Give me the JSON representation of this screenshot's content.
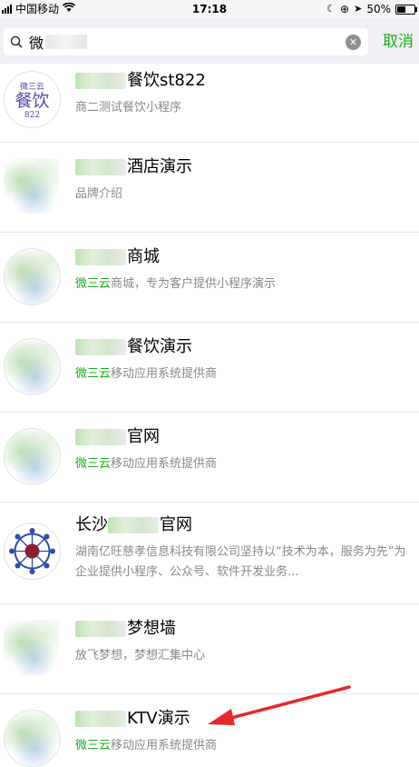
{
  "status": {
    "carrier": "中国移动",
    "time": "17:18",
    "battery_level": "50%",
    "battery_fraction": 0.5
  },
  "search": {
    "query": "微",
    "cancel_label": "取消",
    "clear_icon": "clear-icon",
    "search_icon": "search-icon"
  },
  "results": [
    {
      "title": "餐饮st822",
      "subtitle_highlight": "",
      "subtitle": "商二测试餐饮小程序",
      "logo_top": "微三云",
      "logo_mid": "餐饮",
      "logo_bot": "822"
    },
    {
      "title": "酒店演示",
      "subtitle_highlight": "",
      "subtitle": "品牌介绍"
    },
    {
      "title": "商城",
      "subtitle_highlight": "微三云",
      "subtitle": "商城，专为客户提供小程序演示"
    },
    {
      "title": "餐饮演示",
      "subtitle_highlight": "微三云",
      "subtitle": "移动应用系统提供商"
    },
    {
      "title": "官网",
      "subtitle_highlight": "微三云",
      "subtitle": "移动应用系统提供商"
    },
    {
      "title_prefix": "长沙",
      "title": "官网",
      "subtitle_highlight": "",
      "subtitle": "湖南亿旺慈孝信息科技有限公司坚持以“技术为本，服务为先”为企业提供小程序、公众号、软件开发业务..."
    },
    {
      "title": "梦想墙",
      "subtitle_highlight": "",
      "subtitle": "放飞梦想，梦想汇集中心"
    },
    {
      "title": "KTV演示",
      "subtitle_highlight": "微三云",
      "subtitle": "移动应用系统提供商"
    }
  ],
  "colors": {
    "accent_green": "#1aad19",
    "annotation_arrow": "#e8262b",
    "search_bar_bg": "#f0eff5"
  }
}
